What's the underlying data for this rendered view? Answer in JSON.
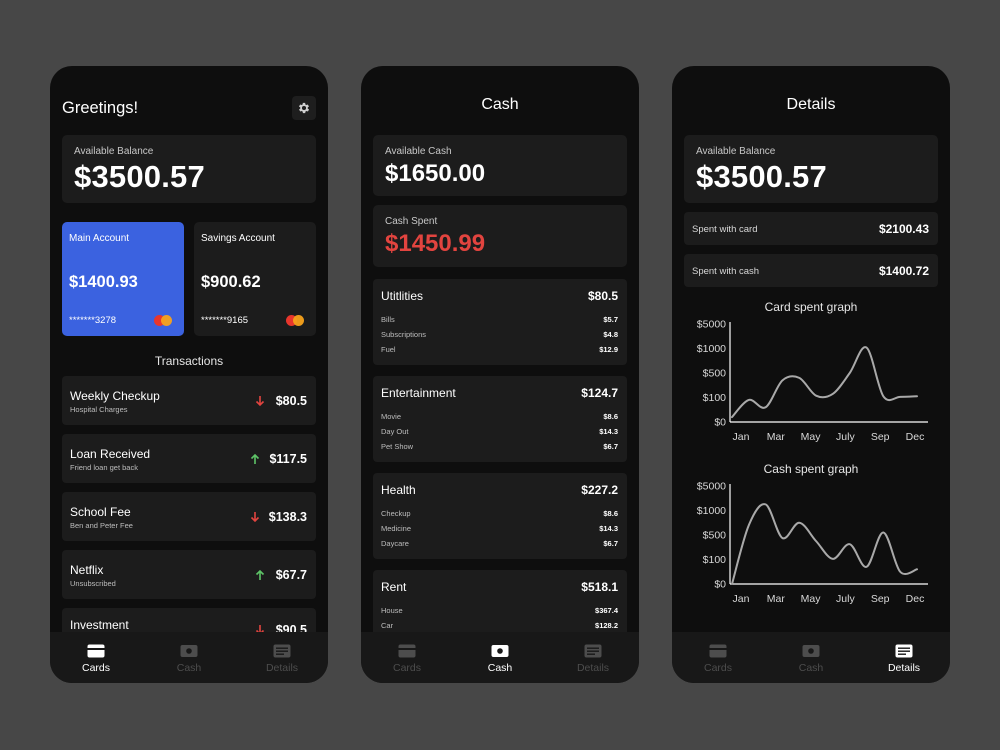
{
  "tabs": [
    "Cards",
    "Cash",
    "Details"
  ],
  "cards_screen": {
    "greeting": "Greetings!",
    "balance_label": "Available Balance",
    "balance": "$3500.57",
    "main_account": {
      "name": "Main Account",
      "amount": "$1400.93",
      "number": "*******3278"
    },
    "savings_account": {
      "name": "Savings Account",
      "amount": "$900.62",
      "number": "*******9165"
    },
    "transactions_title": "Transactions",
    "transactions": [
      {
        "name": "Weekly Checkup",
        "sub": "Hospital Charges",
        "amount": "$80.5",
        "direction": "down"
      },
      {
        "name": "Loan Received",
        "sub": "Friend loan get back",
        "amount": "$117.5",
        "direction": "up"
      },
      {
        "name": "School Fee",
        "sub": "Ben and Peter Fee",
        "amount": "$138.3",
        "direction": "down"
      },
      {
        "name": "Netflix",
        "sub": "Unsubscribed",
        "amount": "$67.7",
        "direction": "up"
      },
      {
        "name": "Investment",
        "sub": "",
        "amount": "$90.5",
        "direction": "down"
      }
    ]
  },
  "cash_screen": {
    "title": "Cash",
    "available_label": "Available Cash",
    "available": "$1650.00",
    "spent_label": "Cash Spent",
    "spent": "$1450.99",
    "categories": [
      {
        "name": "Utitlities",
        "total": "$80.5",
        "items": [
          {
            "label": "Bills",
            "value": "$5.7"
          },
          {
            "label": "Subscriptions",
            "value": "$4.8"
          },
          {
            "label": "Fuel",
            "value": "$12.9"
          }
        ]
      },
      {
        "name": "Entertainment",
        "total": "$124.7",
        "items": [
          {
            "label": "Movie",
            "value": "$8.6"
          },
          {
            "label": "Day Out",
            "value": "$14.3"
          },
          {
            "label": "Pet Show",
            "value": "$6.7"
          }
        ]
      },
      {
        "name": "Health",
        "total": "$227.2",
        "items": [
          {
            "label": "Checkup",
            "value": "$8.6"
          },
          {
            "label": "Medicine",
            "value": "$14.3"
          },
          {
            "label": "Daycare",
            "value": "$6.7"
          }
        ]
      },
      {
        "name": "Rent",
        "total": "$518.1",
        "items": [
          {
            "label": "House",
            "value": "$367.4"
          },
          {
            "label": "Car",
            "value": "$128.2"
          }
        ]
      }
    ]
  },
  "details_screen": {
    "title": "Details",
    "balance_label": "Available Balance",
    "balance": "$3500.57",
    "spent_card_label": "Spent with card",
    "spent_card": "$2100.43",
    "spent_cash_label": "Spent with cash",
    "spent_cash": "$1400.72",
    "card_graph_title": "Card spent graph",
    "cash_graph_title": "Cash spent graph"
  },
  "colors": {
    "accent_blue": "#3b62e0",
    "red": "#e2443f",
    "green": "#5ec467",
    "background": "#474747",
    "phone": "#0e0e0e",
    "panel": "#1c1c1c"
  },
  "chart_data": [
    {
      "type": "line",
      "title": "Card spent graph",
      "y_tick_labels": [
        "$0",
        "$100",
        "$500",
        "$1000",
        "$5000"
      ],
      "x_tick_labels": [
        "Jan",
        "Mar",
        "May",
        "July",
        "Sep",
        "Dec"
      ],
      "x": [
        0,
        1,
        2,
        3,
        4,
        5,
        6,
        7,
        8,
        9,
        10,
        11
      ],
      "values": [
        20,
        90,
        60,
        380,
        420,
        130,
        160,
        500,
        1150,
        120,
        110,
        120
      ]
    },
    {
      "type": "line",
      "title": "Cash spent graph",
      "y_tick_labels": [
        "$0",
        "$100",
        "$500",
        "$1000",
        "$5000"
      ],
      "x_tick_labels": [
        "Jan",
        "Mar",
        "May",
        "July",
        "Sep",
        "Dec"
      ],
      "x": [
        0,
        1,
        2,
        3,
        4,
        5,
        6,
        7,
        8,
        9,
        10,
        11
      ],
      "values": [
        0,
        700,
        2000,
        450,
        750,
        400,
        110,
        350,
        70,
        550,
        50,
        60
      ]
    }
  ]
}
